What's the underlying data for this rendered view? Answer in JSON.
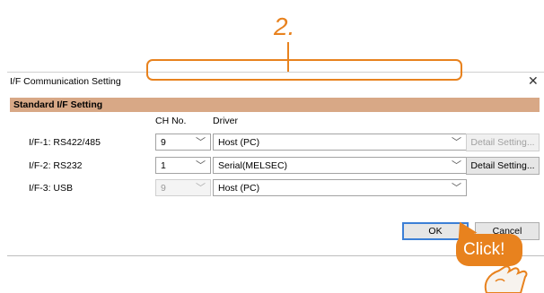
{
  "callout": {
    "step_number": "2.",
    "click_label": "Click!"
  },
  "dialog": {
    "title": "I/F Communication Setting",
    "section_title": "Standard I/F Setting",
    "columns": {
      "ch_no": "CH No.",
      "driver": "Driver"
    },
    "rows": [
      {
        "label": "I/F-1:  RS422/485",
        "ch": "9",
        "driver": "Host (PC)",
        "button": "Detail Setting...",
        "ch_enabled": true,
        "button_enabled": false
      },
      {
        "label": "I/F-2:  RS232",
        "ch": "1",
        "driver": "Serial(MELSEC)",
        "button": "Detail Setting...",
        "ch_enabled": true,
        "button_enabled": true
      },
      {
        "label": "I/F-3:  USB",
        "ch": "9",
        "driver": "Host (PC)",
        "ch_enabled": false
      }
    ],
    "ok_label": "OK",
    "cancel_label": "Cancel"
  },
  "colors": {
    "accent": "#e8821e",
    "section_header": "#d8a886",
    "default_button_border": "#3c7fd6"
  },
  "icons": {
    "close": "close-icon",
    "dropdown": "chevron-down-icon",
    "pointer": "hand-pointer-icon"
  }
}
